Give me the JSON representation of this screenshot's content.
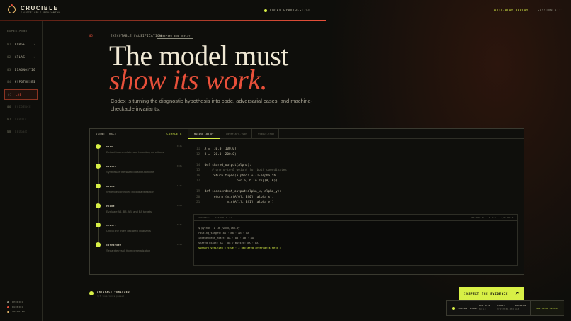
{
  "brand": {
    "name": "CRUCIBLE",
    "subtitle": "FALSIFIABLE REASONING"
  },
  "topbar": {
    "status": "CODEX HYPOTHESIZED",
    "replay": "AUTO-PLAY REPLAY",
    "clock": "SESSION 3:21"
  },
  "sidebar": {
    "heading": "EXPERIMENT",
    "items": [
      {
        "num": "01",
        "label": "FORGE"
      },
      {
        "num": "02",
        "label": "ATLAS"
      },
      {
        "num": "03",
        "label": "DIAGNOSTIC"
      },
      {
        "num": "04",
        "label": "HYPOTHESES"
      },
      {
        "num": "05",
        "label": "LAB"
      },
      {
        "num": "06",
        "label": "EVIDENCE"
      },
      {
        "num": "07",
        "label": "VERDICT"
      },
      {
        "num": "08",
        "label": "LEDGER"
      }
    ],
    "legend": [
      "PENDING",
      "RUNNING",
      "VERIFIED"
    ]
  },
  "hero": {
    "step": "05",
    "eyebrow": "EXECUTABLE FALSIFICATION",
    "tag": "VERIFIED RUN REPLAY",
    "title_line1": "The model must",
    "title_line2": "show its work.",
    "lede": "Codex is turning the diagnostic hypothesis into code, adversarial cases, and machine-checkable invariants."
  },
  "trace": {
    "heading": "AGENT TRACE",
    "status": "COMPLETE",
    "steps": [
      {
        "title": "READ",
        "desc": "Extract learner claim and boundary conditions",
        "meta": "0.4s"
      },
      {
        "title": "DESIGN",
        "desc": "Synthesize the shared distribution line",
        "meta": "0.8s"
      },
      {
        "title": "BUILD",
        "desc": "Write the controlled mixing abstraction",
        "meta": "1.2s"
      },
      {
        "title": "PROBE",
        "desc": "Evaluate A4, B8, AB, and B8 targets",
        "meta": "0.6s"
      },
      {
        "title": "VERIFY",
        "desc": "Check the three declared invariants",
        "meta": "0.3s"
      },
      {
        "title": "INTERPRET",
        "desc": "Separate result from generalization",
        "meta": "0.2s"
      }
    ]
  },
  "editor": {
    "tabs": [
      "mixing_lab.py",
      "adversary.json",
      "stdout.json"
    ],
    "code": [
      {
        "n": "11",
        "text": "A = (10.0, 100.0)"
      },
      {
        "n": "12",
        "text": "B = (20.0, 200.0)"
      },
      {
        "n": "",
        "text": ""
      },
      {
        "n": "14",
        "text": "def shared_output(alpha):"
      },
      {
        "n": "15",
        "text": "    # one α-to-β weight for both coordinates",
        "comment": true
      },
      {
        "n": "16",
        "text": "    return tuple(alpha*a + (1-alpha)*b"
      },
      {
        "n": "17",
        "text": "                 for a, b in zip(A, B))"
      },
      {
        "n": "",
        "text": ""
      },
      {
        "n": "19",
        "text": "def independent_output(alpha_x, alpha_y):"
      },
      {
        "n": "20",
        "text": "    return (mix(A[0], B[0], alpha_x),"
      },
      {
        "n": "21",
        "text": "            mix(A[1], B[1], alpha_y))"
      }
    ],
    "terminal": {
      "left": "TERMINAL · PYTHON 3.11",
      "right": "EXITED 0 · 0.41s · 3/3 PASS",
      "lines": [
        {
          "text": "$ python -I -B /work/lab.py"
        },
        {
          "text": "routing_target: 8A · 88 · AB · 8A"
        },
        {
          "text": "independent_exact: 8A · 88 · AB · 8A"
        },
        {
          "text": "shared_exact: 8A · 88 / missed: 8A · 8A"
        },
        {
          "text": "summary.verified = true · 3 declared invariants held ✓",
          "ok": true
        }
      ]
    }
  },
  "artifact": {
    "title": "ARTIFACT VERIFIED",
    "sub": "3/3 invariants passed"
  },
  "cta": {
    "label": "INSPECT THE EVIDENCE",
    "arrow": "↗"
  },
  "dock": {
    "cells": [
      {
        "label": "CURRENT STAGE",
        "value": ""
      },
      {
        "label": "APR 0.4",
        "value": "BUILD"
      },
      {
        "label": "CODEX",
        "value": "HYPOTHESIZED"
      },
      {
        "label": "RUNNING",
        "value": "LAB"
      }
    ],
    "replay": "VERIFIED REPLAY"
  },
  "colors": {
    "accent": "#d8f046",
    "brand_red": "#e8503a",
    "bg": "#0e0e0b"
  }
}
